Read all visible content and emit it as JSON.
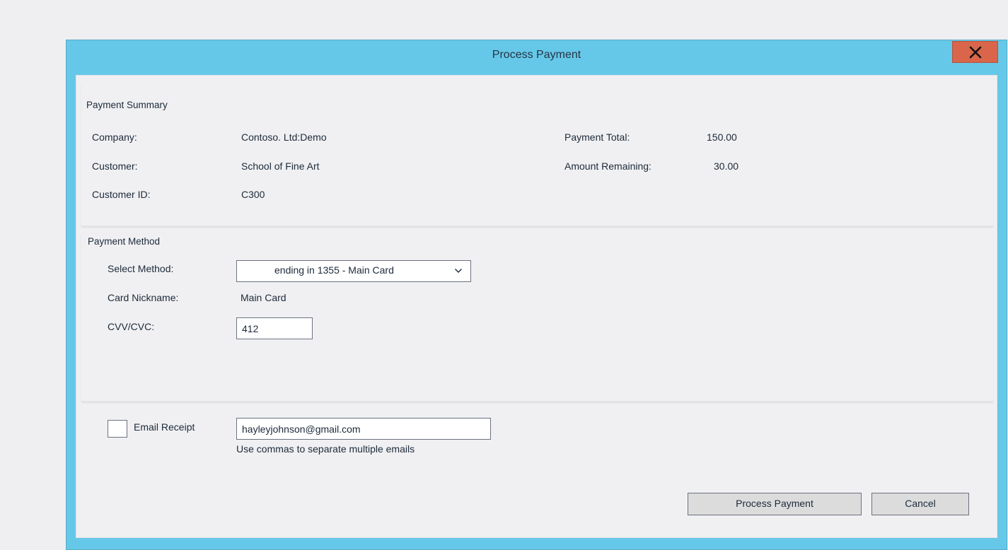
{
  "dialog": {
    "title": "Process Payment",
    "close_icon": "close-icon"
  },
  "summary": {
    "title": "Payment Summary",
    "company_label": "Company:",
    "company_value": "Contoso. Ltd:Demo",
    "customer_label": "Customer:",
    "customer_value": "School of Fine Art",
    "customer_id_label": "Customer ID:",
    "customer_id_value": "C300",
    "payment_total_label": "Payment Total:",
    "payment_total_value": "150.00",
    "amount_remaining_label": "Amount Remaining:",
    "amount_remaining_value": "30.00"
  },
  "method": {
    "title": "Payment Method",
    "select_label": "Select Method:",
    "select_value": "ending in 1355 - Main Card",
    "nickname_label": "Card Nickname:",
    "nickname_value": "Main Card",
    "cvv_label": "CVV/CVC:",
    "cvv_value": "412"
  },
  "receipt": {
    "checkbox_label": "Email Receipt",
    "checked": false,
    "email_value": "hayleyjohnson@gmail.com",
    "hint": "Use commas to separate multiple emails"
  },
  "actions": {
    "process_label": "Process Payment",
    "cancel_label": "Cancel"
  },
  "colors": {
    "titlebar": "#66c8e8",
    "close_button": "#d9654b",
    "panel": "#f0f0f2",
    "button": "#dcdcdc"
  }
}
